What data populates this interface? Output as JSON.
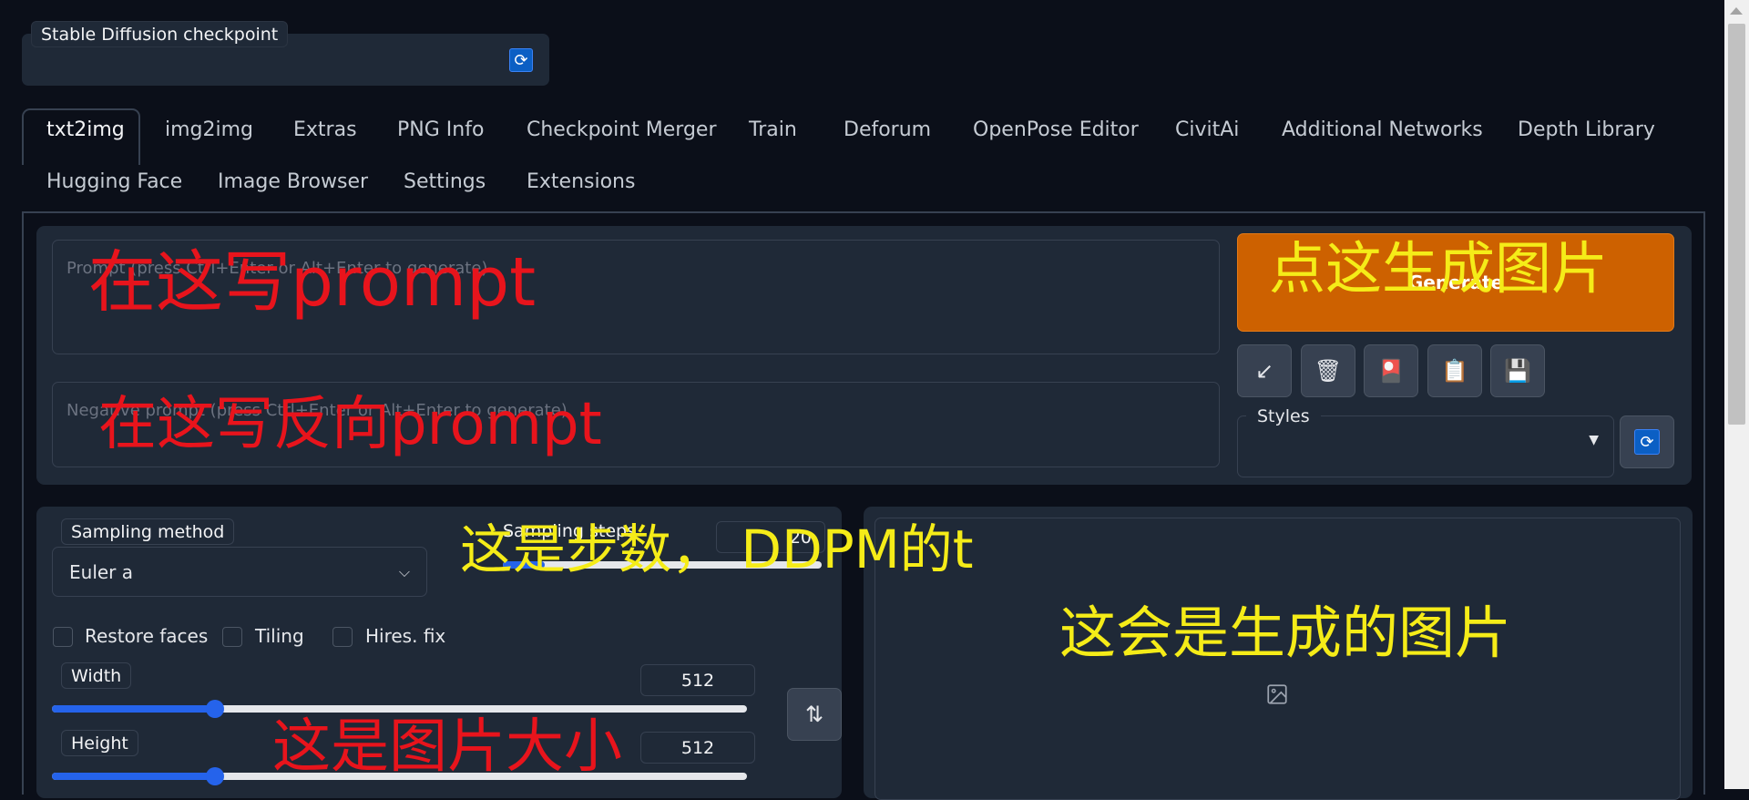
{
  "checkpoint": {
    "label": "Stable Diffusion checkpoint",
    "value": ""
  },
  "tabs": {
    "row1": [
      "txt2img",
      "img2img",
      "Extras",
      "PNG Info",
      "Checkpoint Merger",
      "Train",
      "Deforum",
      "OpenPose Editor",
      "CivitAi",
      "Additional Networks",
      "Depth Library"
    ],
    "row2": [
      "Hugging Face",
      "Image Browser",
      "Settings",
      "Extensions"
    ],
    "active": "txt2img"
  },
  "prompt": {
    "placeholder": "Prompt (press Ctrl+Enter or Alt+Enter to generate)",
    "value": ""
  },
  "negative_prompt": {
    "placeholder": "Negative prompt (press Ctrl+Enter or Alt+Enter to generate)",
    "value": ""
  },
  "generate_button": {
    "label": "Generate"
  },
  "tool_buttons": [
    {
      "icon": "arrow-down-left-icon",
      "glyph": "↙"
    },
    {
      "icon": "trash-icon",
      "glyph": "🗑"
    },
    {
      "icon": "red-card-icon",
      "glyph": "🎴"
    },
    {
      "icon": "clipboard-icon",
      "glyph": "📋"
    },
    {
      "icon": "save-icon",
      "glyph": "💾"
    }
  ],
  "styles": {
    "label": "Styles",
    "value": ""
  },
  "sampling": {
    "method_label": "Sampling method",
    "method_value": "Euler a",
    "steps_label": "Sampling steps",
    "steps_value": "20",
    "steps_fraction": 0.13
  },
  "checkboxes": [
    {
      "label": "Restore faces",
      "checked": false
    },
    {
      "label": "Tiling",
      "checked": false
    },
    {
      "label": "Hires. fix",
      "checked": false
    }
  ],
  "width": {
    "label": "Width",
    "value": "512",
    "fraction": 0.23
  },
  "height": {
    "label": "Height",
    "value": "512",
    "fraction": 0.23
  },
  "annotations": {
    "prompt_note": "在这写prompt",
    "negative_note": "在这写反向prompt",
    "generate_note": "点这生成图片",
    "steps_note": "这是步数，  DDPM的t",
    "output_note": "这会是生成的图片",
    "size_note": "这是图片大小"
  },
  "colors": {
    "accent": "#cd6100",
    "slider": "#2563eb",
    "background": "#0b0f19",
    "panel": "#1f2937"
  }
}
